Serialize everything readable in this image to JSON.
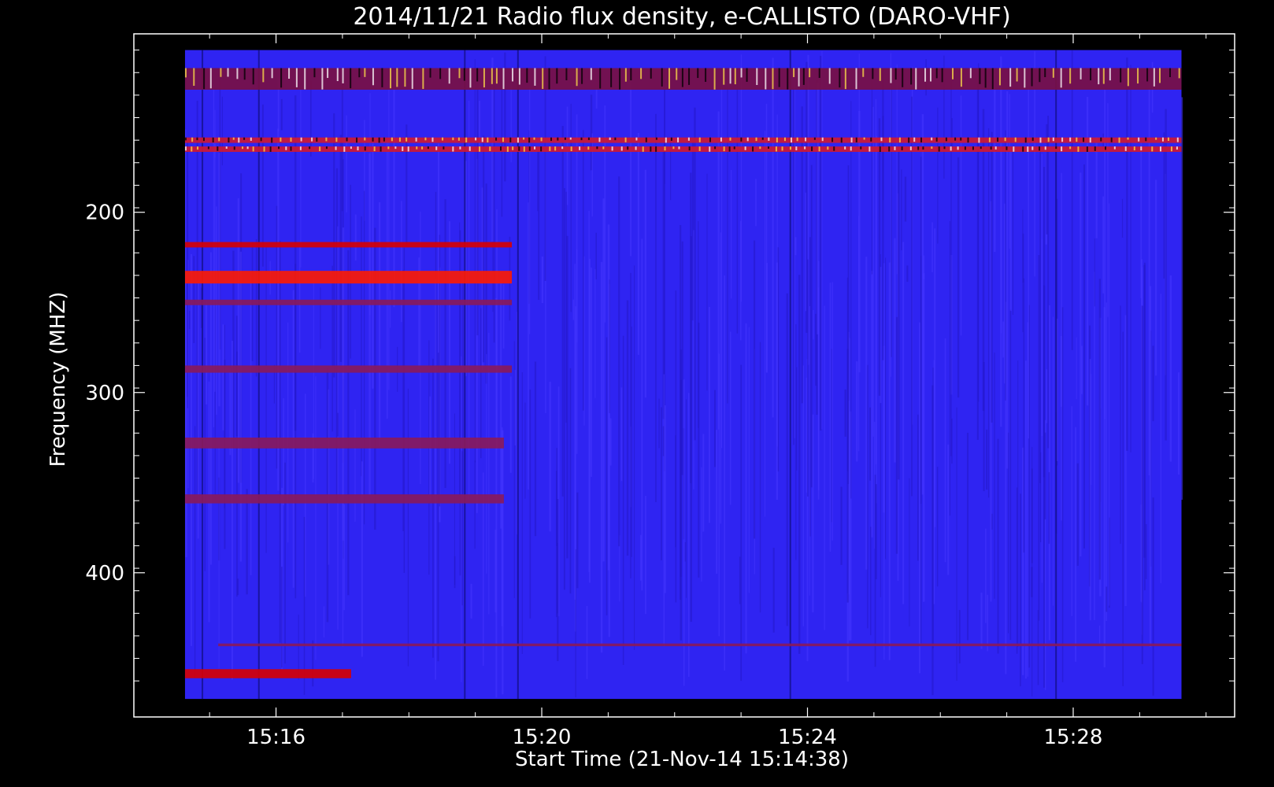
{
  "chart_data": {
    "type": "heatmap",
    "title": "2014/11/21  Radio flux density, e-CALLISTO (DARO-VHF)",
    "xlabel": "Start Time (21-Nov-14 15:14:38)",
    "ylabel": "Frequency (MHZ)",
    "x_tick_labels": [
      "15:16",
      "15:20",
      "15:24",
      "15:28"
    ],
    "x_tick_minutes": [
      1.37,
      5.37,
      9.37,
      13.37
    ],
    "y_tick_labels": [
      "200",
      "300",
      "400"
    ],
    "y_ticks": [
      200,
      300,
      400
    ],
    "xlim_minutes": [
      -0.77,
      15.8
    ],
    "ylim_mhz": [
      480,
      101
    ],
    "data_xlim_minutes": [
      0,
      15.0
    ],
    "data_ylim_mhz": [
      470,
      110
    ],
    "colormap": [
      "#000000",
      "#2a1ad8",
      "#3b2cff",
      "#8a1a6a",
      "#e00000",
      "#ff3a00",
      "#ffd23a"
    ],
    "background_level": "blue",
    "features": [
      {
        "type": "band",
        "freq_mhz": 126,
        "width_mhz": 12,
        "t_start_min": 0,
        "t_end_min": 15.0,
        "intensity": "mixed red/black/yellow"
      },
      {
        "type": "band",
        "freq_mhz": 160,
        "width_mhz": 3,
        "t_start_min": 0,
        "t_end_min": 15.0,
        "intensity": "striped red/white"
      },
      {
        "type": "band",
        "freq_mhz": 165,
        "width_mhz": 3,
        "t_start_min": 0,
        "t_end_min": 15.0,
        "intensity": "striped red/white"
      },
      {
        "type": "band",
        "freq_mhz": 218,
        "width_mhz": 3,
        "t_start_min": 0,
        "t_end_min": 4.92,
        "intensity": "red"
      },
      {
        "type": "band",
        "freq_mhz": 236,
        "width_mhz": 7,
        "t_start_min": 0,
        "t_end_min": 4.92,
        "intensity": "bright red"
      },
      {
        "type": "band",
        "freq_mhz": 250,
        "width_mhz": 3,
        "t_start_min": 0,
        "t_end_min": 4.92,
        "intensity": "dark red"
      },
      {
        "type": "band",
        "freq_mhz": 287,
        "width_mhz": 4,
        "t_start_min": 0,
        "t_end_min": 4.92,
        "intensity": "dark red"
      },
      {
        "type": "band",
        "freq_mhz": 328,
        "width_mhz": 6,
        "t_start_min": 0,
        "t_end_min": 4.8,
        "intensity": "dark red"
      },
      {
        "type": "band",
        "freq_mhz": 359,
        "width_mhz": 5,
        "t_start_min": 0,
        "t_end_min": 4.8,
        "intensity": "dark red"
      },
      {
        "type": "band",
        "freq_mhz": 440,
        "width_mhz": 1.5,
        "t_start_min": 0.5,
        "t_end_min": 15.0,
        "intensity": "dark red"
      },
      {
        "type": "band",
        "freq_mhz": 456,
        "width_mhz": 5,
        "t_start_min": 0,
        "t_end_min": 2.5,
        "intensity": "red"
      }
    ]
  }
}
